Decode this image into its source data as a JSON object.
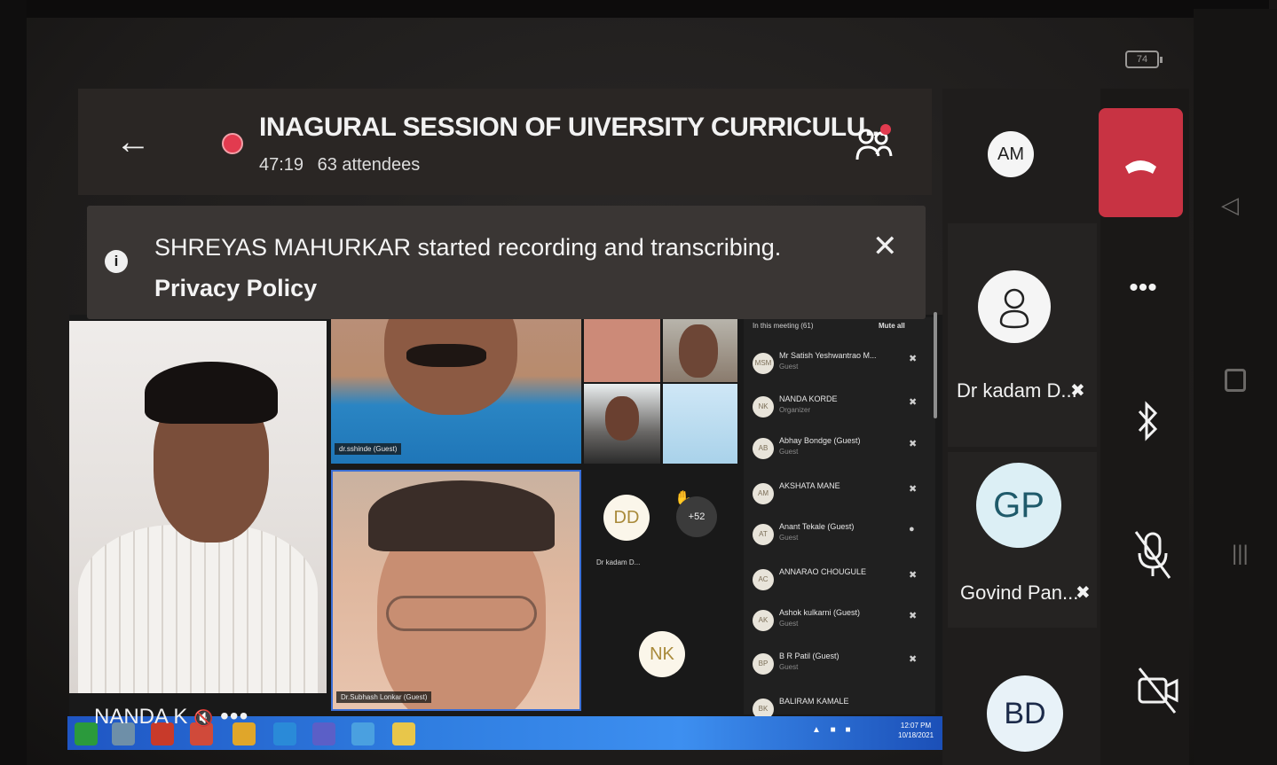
{
  "status": {
    "battery": "74"
  },
  "meeting": {
    "title": "INAGURAL SESSION OF  UIVERSITY CURRICULU...",
    "elapsed": "47:19",
    "attendees": "63 attendees"
  },
  "banner": {
    "message": "SHREYAS MAHURKAR started recording and transcribing.",
    "link": "Privacy Policy"
  },
  "grid": {
    "tile_a_label": "dr.sshinde (Guest)",
    "tile_f_label": "Dr.Subhash Lonkar (Guest)",
    "dd_initials": "DD",
    "dd_name": "Dr kadam D...",
    "more_count": "+52",
    "nk_initials": "NK"
  },
  "panel": {
    "header": "In this meeting (61)",
    "mute_all": "Mute all",
    "participants": [
      {
        "initials": "MSM",
        "name": "Mr Satish Yeshwantrao M...",
        "role": "Guest"
      },
      {
        "initials": "NK",
        "name": "NANDA KORDE",
        "role": "Organizer"
      },
      {
        "initials": "AB",
        "name": "Abhay Bondge (Guest)",
        "role": "Guest"
      },
      {
        "initials": "AM",
        "name": "AKSHATA MANE",
        "role": ""
      },
      {
        "initials": "AT",
        "name": "Anant Tekale (Guest)",
        "role": "Guest"
      },
      {
        "initials": "AC",
        "name": "ANNARAO CHOUGULE",
        "role": ""
      },
      {
        "initials": "AK",
        "name": "Ashok kulkarni (Guest)",
        "role": "Guest"
      },
      {
        "initials": "BP",
        "name": "B R Patil (Guest)",
        "role": "Guest"
      },
      {
        "initials": "BK",
        "name": "BALIRAM KAMALE",
        "role": ""
      }
    ]
  },
  "taskbar": {
    "time": "12:07 PM",
    "date": "10/18/2021"
  },
  "bottom": {
    "name": "NANDA K",
    "more": "•••"
  },
  "right": {
    "am_initials": "AM",
    "kadam_label": "Dr kadam D...",
    "gp_initials": "GP",
    "gp_label": "Govind Pan...",
    "bd_initials": "BD",
    "more": "•••"
  },
  "colors": {
    "hangup": "#c83343",
    "recording": "#e23b4f",
    "taskbar": "#2f7de0"
  }
}
